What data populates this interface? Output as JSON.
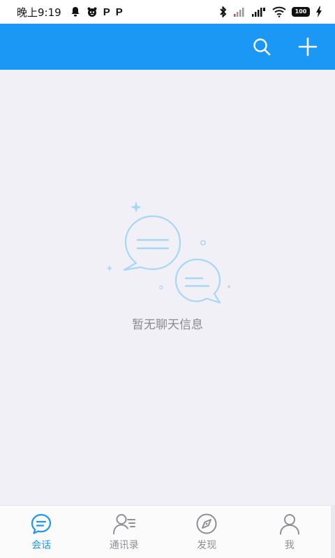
{
  "status_bar": {
    "time": "晚上9:19",
    "p_glyph_1": "P",
    "p_glyph_2": "P",
    "battery": "100"
  },
  "app_bar": {
    "background": "#1b97f5",
    "search_icon": "search-icon",
    "add_icon": "plus-icon"
  },
  "empty_state": {
    "message": "暂无聊天信息",
    "illustration": "chat-bubbles-illustration"
  },
  "bottom_nav": {
    "active_color": "#1b97f5",
    "inactive_color": "#8f8f95",
    "items": [
      {
        "label": "会话",
        "icon": "chat-icon",
        "active": true
      },
      {
        "label": "通讯录",
        "icon": "contacts-icon",
        "active": false
      },
      {
        "label": "发现",
        "icon": "compass-icon",
        "active": false
      },
      {
        "label": "我",
        "icon": "profile-icon",
        "active": false
      }
    ]
  }
}
